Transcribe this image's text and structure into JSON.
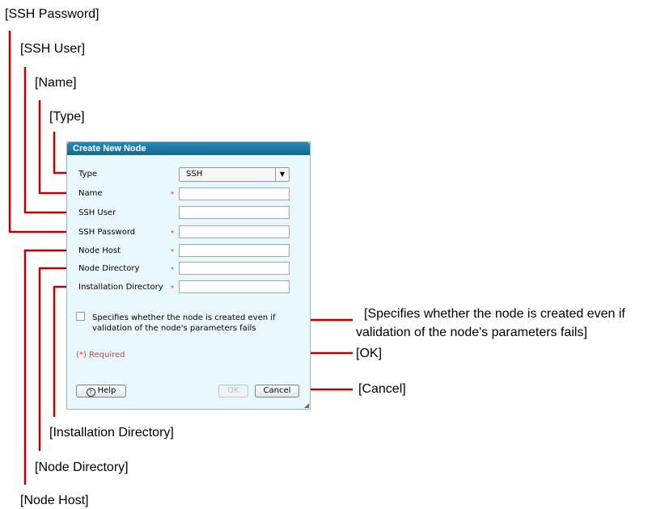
{
  "callouts": {
    "ssh_password": "[SSH Password]",
    "ssh_user": "[SSH User]",
    "name": "[Name]",
    "type": "[Type]",
    "validation_line1": "[Specifies whether the node is created even if",
    "validation_line2": "validation of the node's parameters fails]",
    "ok": "[OK]",
    "cancel": "[Cancel]",
    "installation_directory": "[Installation Directory]",
    "node_directory": "[Node Directory]",
    "node_host": "[Node Host]"
  },
  "dialog": {
    "title": "Create New Node",
    "fields": {
      "type_label": "Type",
      "type_value": "SSH",
      "name_label": "Name",
      "ssh_user_label": "SSH User",
      "ssh_password_label": "SSH Password",
      "node_host_label": "Node Host",
      "node_directory_label": "Node Directory",
      "installation_directory_label": "Installation Directory",
      "required_marker": "*"
    },
    "checkbox_text": "Specifies whether the node is created even if validation of the node's parameters fails",
    "required_note": "(*) Required",
    "buttons": {
      "help": "Help",
      "help_glyph": "?",
      "ok": "OK",
      "cancel": "Cancel",
      "dropdown_glyph": "▼"
    }
  },
  "colors": {
    "callout_line": "#c00000",
    "title_bar": "#1b78a2",
    "dialog_bg": "#e8f8fc",
    "required": "#d23c3c"
  }
}
